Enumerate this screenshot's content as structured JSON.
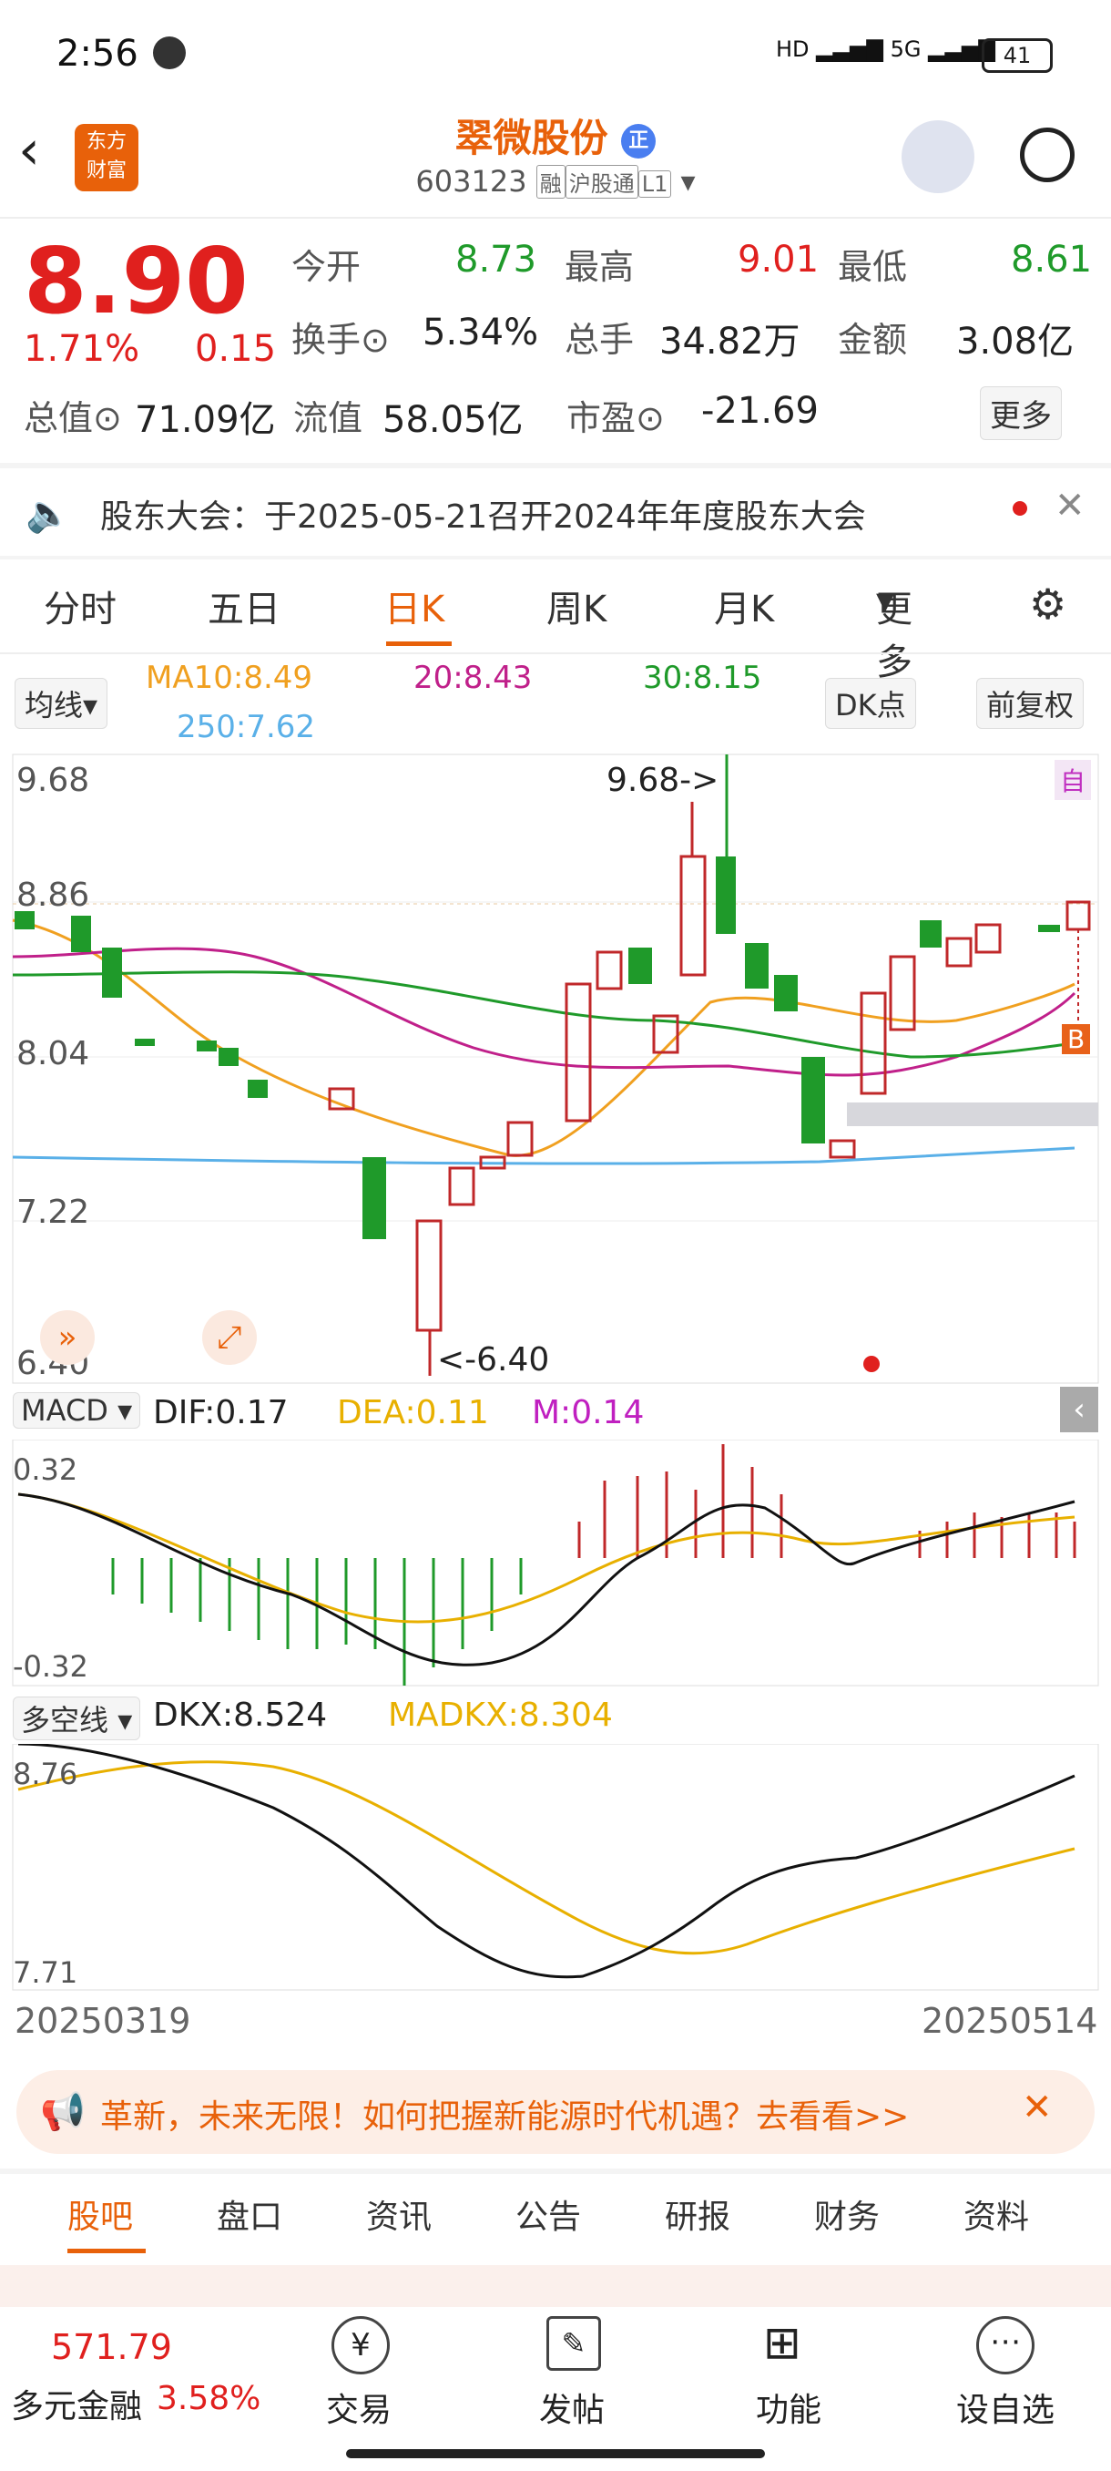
{
  "status": {
    "time": "2:56",
    "battery": "41"
  },
  "header": {
    "title": "翠微股份",
    "badge": "正",
    "code": "603123",
    "tags": [
      "融",
      "沪股通",
      "L1"
    ]
  },
  "quote": {
    "price": "8.90",
    "change_pct": "1.71%",
    "change": "0.15",
    "stats": [
      {
        "label": "今开",
        "value": "8.73",
        "color": "green"
      },
      {
        "label": "最高",
        "value": "9.01",
        "color": "red"
      },
      {
        "label": "最低",
        "value": "8.61",
        "color": "green"
      },
      {
        "label": "换手",
        "value": "5.34%",
        "color": "black"
      },
      {
        "label": "总手",
        "value": "34.82万",
        "color": "black"
      },
      {
        "label": "金额",
        "value": "3.08亿",
        "color": "black"
      },
      {
        "label": "总值",
        "value": "71.09亿",
        "color": "black"
      },
      {
        "label": "流值",
        "value": "58.05亿",
        "color": "black"
      },
      {
        "label": "市盈",
        "value": "-21.69",
        "color": "black"
      }
    ],
    "more": "更多"
  },
  "notice": {
    "text": "股东大会：于2025-05-21召开2024年年度股东大会"
  },
  "tabs": [
    "分时",
    "五日",
    "日K",
    "周K",
    "月K",
    "更多"
  ],
  "active_tab": "日K",
  "ma": {
    "select": "均线",
    "ma10": "MA10:8.49",
    "ma20": "20:8.43",
    "ma30": "30:8.15",
    "ma250": "250:7.62",
    "dk": "DK点",
    "fq": "前复权"
  },
  "kaxis": {
    "y": [
      "9.68",
      "8.86",
      "8.04",
      "7.22",
      "6.40"
    ],
    "high_label": "9.68->",
    "low_label": "<-6.40",
    "self": "自",
    "b": "B"
  },
  "macd": {
    "select": "MACD",
    "dif": "DIF:0.17",
    "dea": "DEA:0.11",
    "m": "M:0.14",
    "ymax": "0.32",
    "ymin": "-0.32"
  },
  "dkx": {
    "select": "多空线",
    "dkx": "DKX:8.524",
    "madkx": "MADKX:8.304",
    "ymax": "8.76",
    "ymin": "7.71"
  },
  "dates": {
    "start": "20250319",
    "end": "20250514"
  },
  "ad": {
    "text": "革新，未来无限！如何把握新能源时代机遇？去看看>>"
  },
  "bottom_tabs": [
    "股吧",
    "盘口",
    "资讯",
    "公告",
    "研报",
    "财务",
    "资料"
  ],
  "ticker": {
    "value": "571.79",
    "name": "多元金融",
    "pct": "3.58%"
  },
  "bottom_nav": [
    "交易",
    "发帖",
    "功能",
    "设自选"
  ],
  "colors": {
    "up": "#e0201e",
    "down": "#1f9a2a",
    "ma10": "#f0a020",
    "ma20": "#c0208a",
    "ma30": "#1f9a2a",
    "ma250": "#5ab0e8",
    "accent": "#e8610a"
  }
}
